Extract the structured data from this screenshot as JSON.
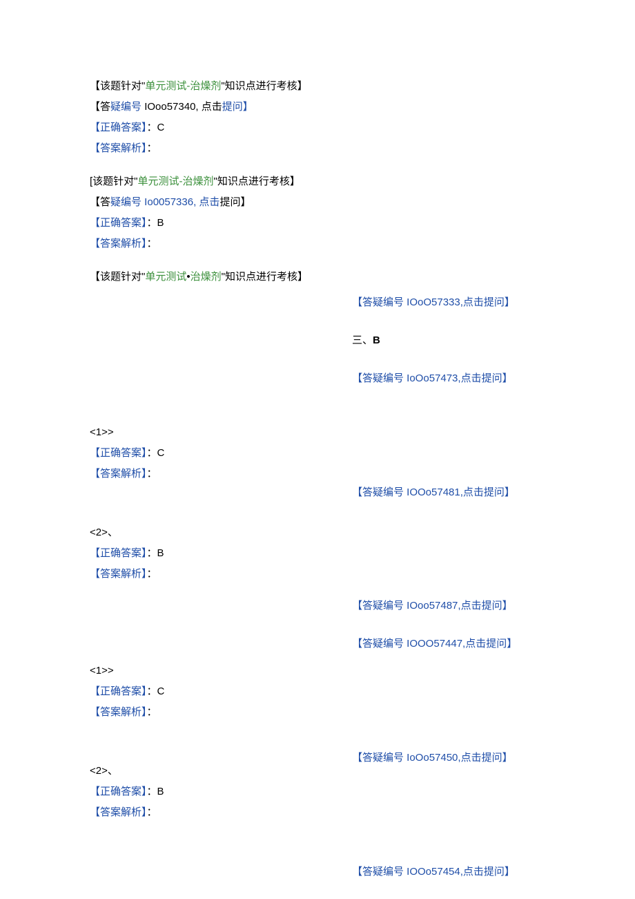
{
  "block1": {
    "l1_pre": "【该题针对\"",
    "l1_green": "单元测试-治燥剂",
    "l1_post": "\"知识点进行考核】",
    "l2_a": "【答",
    "l2_b": "疑编号 ",
    "l2_c": "IOoo57340, 点击",
    "l2_d": "提问】",
    "l3_a": "【正确答案】",
    "l3_b": "：C",
    "l4_a": "【答案解析】",
    "l4_b": "："
  },
  "block2": {
    "l1_pre": "[该题针对\"",
    "l1_green": "单元测试-治燥剂",
    "l1_post": "\"知识点进行考核】",
    "l2_a": "【答",
    "l2_b": "疑编号 Io0057336, 点击",
    "l2_c": "提问】",
    "l3_a": "【正确答案】",
    "l3_b": "：B",
    "l4_a": "【答案解析】",
    "l4_b": "："
  },
  "block3": {
    "l1_pre": "【该题针对\"",
    "l1_green1": "单元测试",
    "l1_mid": "•",
    "l1_green2": "治燥剂",
    "l1_post": "\"知识点进行考核】"
  },
  "right": {
    "r1": "【答疑编号 IOoO57333,点击提问】",
    "sec_a": "三、",
    "sec_b": "B",
    "r2": "【答疑编号 IoOo57473,点击提问】",
    "r3": "【答疑编号 IOOo57481,点击提问】",
    "r4": "【答疑编号 IOoo57487,点击提问】",
    "r5": "【答疑编号 IOOO57447,点击提问】",
    "r6": "【答疑编号 IoOo57450,点击提问】",
    "r7": "【答疑编号 IOOo57454,点击提问】"
  },
  "qa1": {
    "tag": "<1>>",
    "l1_a": "【正确答案】",
    "l1_b": "：C",
    "l2_a": "【答案解析】",
    "l2_b": "："
  },
  "qa2": {
    "tag": "<2>、",
    "l1_a": "【正确答案】",
    "l1_b": "：B",
    "l2_a": "【答案解析】",
    "l2_b": "："
  },
  "qa3": {
    "tag": "<1>>",
    "l1_a": "【正确答案】",
    "l1_b": "：C",
    "l2_a": "【答案解析】",
    "l2_b": "："
  },
  "qa4": {
    "tag": "<2>、",
    "l1_a": "【正确答案】",
    "l1_b": "：B",
    "l2_a": "【答案解析】",
    "l2_b": "："
  }
}
